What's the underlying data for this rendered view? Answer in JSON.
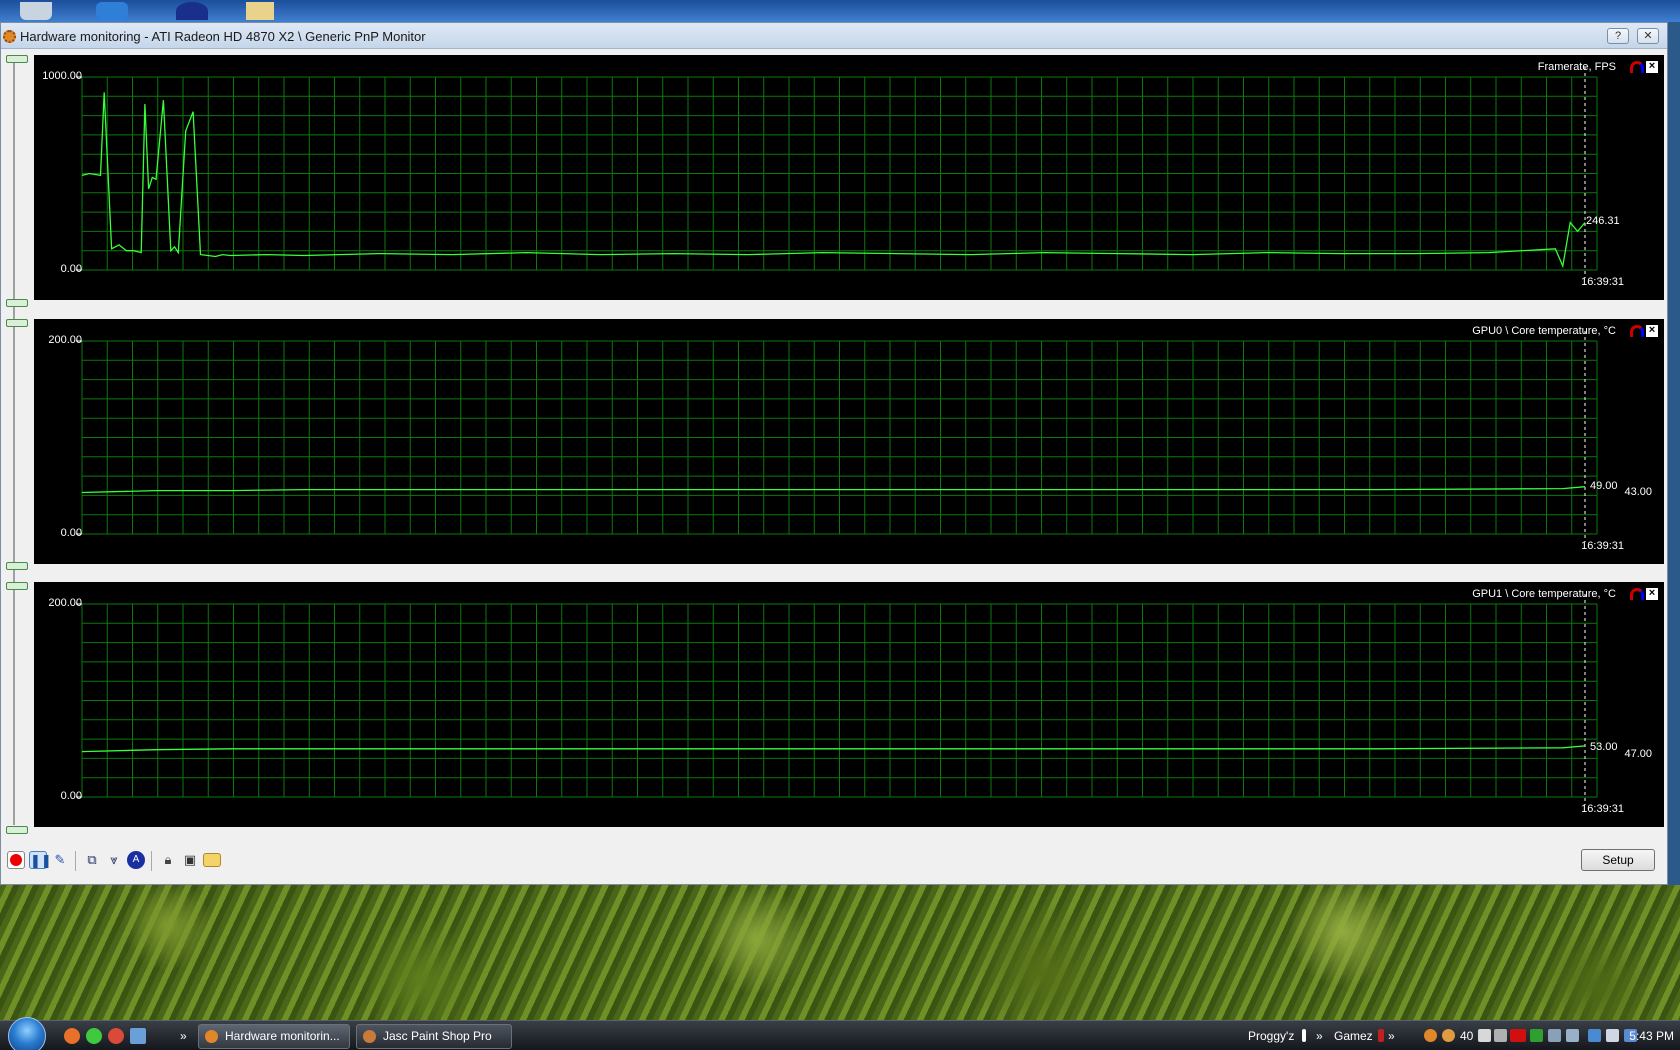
{
  "window": {
    "title": "Hardware monitoring - ATI Radeon HD 4870 X2  \\ Generic PnP Monitor",
    "help_label": "?",
    "close_label": "✕"
  },
  "graphs": [
    {
      "title": "Framerate, FPS",
      "y_max_label": "1000.00",
      "y_min_label": "0.00",
      "current_value": "246.31",
      "side_value": "",
      "time_label": "16:39:31"
    },
    {
      "title": "GPU0 \\ Core temperature, °C",
      "y_max_label": "200.00",
      "y_min_label": "0.00",
      "current_value": "49.00",
      "side_value": "43.00",
      "time_label": "16:39:31"
    },
    {
      "title": "GPU1 \\ Core temperature, °C",
      "y_max_label": "200.00",
      "y_min_label": "0.00",
      "current_value": "53.00",
      "side_value": "47.00",
      "time_label": "16:39:31"
    }
  ],
  "chart_data": [
    {
      "type": "line",
      "title": "Framerate, FPS",
      "ylim": [
        0,
        1000
      ],
      "grid": true,
      "x": [
        0,
        2,
        5,
        6,
        8,
        10,
        12,
        14,
        16,
        17,
        18,
        19,
        20,
        22,
        24,
        25,
        26,
        28,
        30,
        32,
        34,
        36,
        38,
        40,
        50,
        60,
        80,
        100,
        120,
        140,
        160,
        180,
        200,
        220,
        240,
        260,
        280,
        300,
        320,
        340,
        360,
        380,
        398,
        400,
        402,
        404,
        406
      ],
      "series": [
        {
          "values": [
            490,
            500,
            490,
            920,
            110,
            130,
            100,
            100,
            90,
            860,
            420,
            480,
            470,
            880,
            100,
            120,
            90,
            720,
            820,
            80,
            75,
            70,
            80,
            75,
            80,
            75,
            85,
            80,
            90,
            80,
            85,
            80,
            90,
            85,
            80,
            90,
            85,
            80,
            90,
            85,
            85,
            90,
            110,
            20,
            246,
            200,
            246
          ]
        }
      ]
    },
    {
      "type": "line",
      "title": "GPU0 \\ Core temperature, °C",
      "ylim": [
        0,
        200
      ],
      "grid": true,
      "x": [
        0,
        20,
        40,
        60,
        80,
        100,
        150,
        200,
        250,
        300,
        350,
        400,
        406
      ],
      "series": [
        {
          "values": [
            43,
            45,
            45,
            46,
            46,
            46,
            46,
            46,
            46,
            46,
            46,
            47,
            49
          ]
        }
      ]
    },
    {
      "type": "line",
      "title": "GPU1 \\ Core temperature, °C",
      "ylim": [
        0,
        200
      ],
      "grid": true,
      "x": [
        0,
        20,
        40,
        60,
        80,
        100,
        150,
        200,
        250,
        300,
        350,
        400,
        406
      ],
      "series": [
        {
          "values": [
            47,
            49,
            50,
            50,
            50,
            50,
            50,
            50,
            50,
            50,
            50,
            51,
            53
          ]
        }
      ]
    }
  ],
  "toolbar": {
    "setup_label": "Setup"
  },
  "taskbar": {
    "items": [
      {
        "label": "Hardware monitorin..."
      },
      {
        "label": "Jasc Paint Shop Pro"
      }
    ],
    "tray_label_1": "Proggy'z",
    "tray_label_2": "Gamez",
    "tray_number": "40",
    "clock": "5:43 PM"
  },
  "colors": {
    "line": "#39ff39",
    "grid": "#0b7a0b",
    "pane_bg": "#000000"
  }
}
